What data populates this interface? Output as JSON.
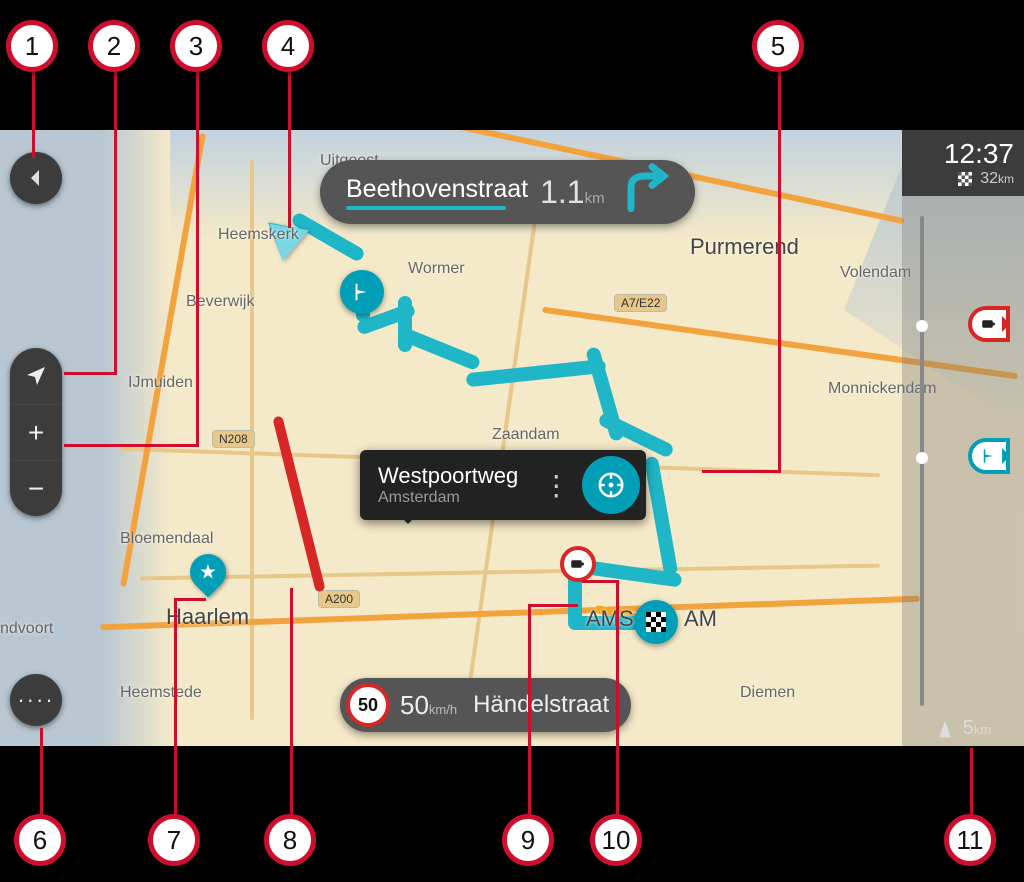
{
  "instruction": {
    "street": "Beethovenstraat",
    "distance_value": "1.1",
    "distance_unit": "km",
    "maneuver": "turn-right"
  },
  "selected_location": {
    "title": "Westpoortweg",
    "subtitle": "Amsterdam",
    "more_label": "⋮",
    "go_icon": "steering-wheel"
  },
  "speed_panel": {
    "limit": "50",
    "current_value": "50",
    "current_unit": "km/h",
    "street": "Händelstraat"
  },
  "route_bar": {
    "clock": "12:37",
    "remaining_value": "32",
    "remaining_unit": "km",
    "scale_value": "5",
    "scale_unit": "km",
    "events": [
      {
        "type": "speed-camera"
      },
      {
        "type": "waypoint-flag"
      }
    ]
  },
  "map_labels": {
    "heemskerk": "Heemskerk",
    "beverwijk": "Beverwijk",
    "ijmuiden": "IJmuiden",
    "bloemendaal": "Bloemendaal",
    "haarlem": "Haarlem",
    "heemstede": "Heemstede",
    "ndvoort": "ndvoort",
    "uitgeest": "Uitgeest",
    "wormer": "Wormer",
    "zaandam": "Zaandam",
    "purmerend": "Purmerend",
    "volendam": "Volendam",
    "monnickendam": "Monnickendam",
    "amsterdam_left": "AMS",
    "amsterdam_right": "AM",
    "diemen": "Diemen"
  },
  "road_shields": {
    "n208": "N208",
    "a200": "A200",
    "a7e22": "A7/E22"
  },
  "buttons": {
    "back": "back-arrow",
    "view_switch": "nav-arrow",
    "zoom_in": "+",
    "zoom_out": "−",
    "menu": "····"
  },
  "callouts": [
    "1",
    "2",
    "3",
    "4",
    "5",
    "6",
    "7",
    "8",
    "9",
    "10",
    "11"
  ]
}
